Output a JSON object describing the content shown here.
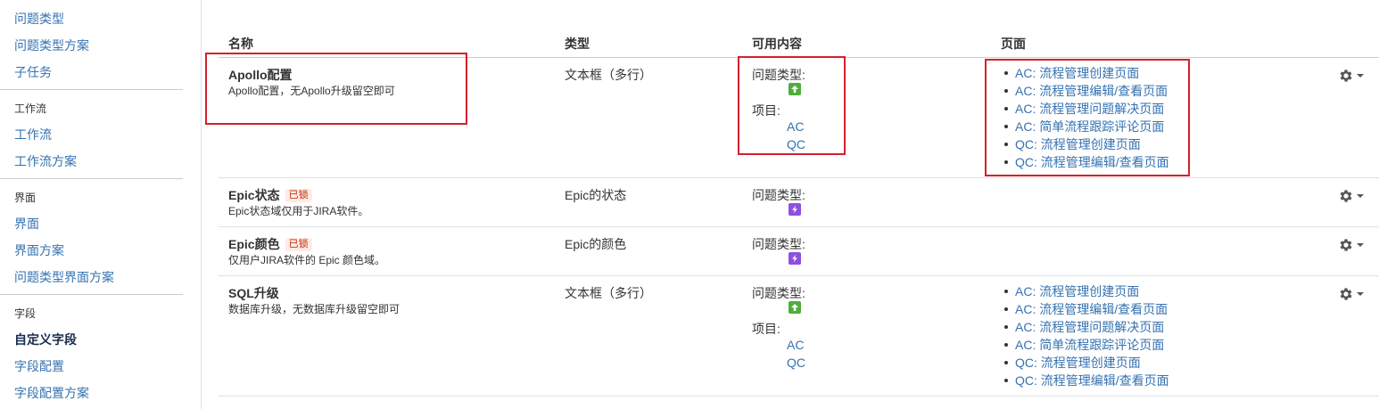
{
  "sidebar": {
    "links_top": [
      "问题类型",
      "问题类型方案",
      "子任务"
    ],
    "sections": [
      {
        "heading": "工作流",
        "items": [
          "工作流",
          "工作流方案"
        ]
      },
      {
        "heading": "界面",
        "items": [
          "界面",
          "界面方案",
          "问题类型界面方案"
        ]
      },
      {
        "heading": "字段",
        "items": [
          "自定义字段",
          "字段配置",
          "字段配置方案"
        ]
      }
    ],
    "current_item": "自定义字段"
  },
  "table": {
    "headers": {
      "name": "名称",
      "type": "类型",
      "context": "可用内容",
      "screens": "页面"
    },
    "issue_type_label": "问题类型:",
    "project_label": "项目:",
    "rows": [
      {
        "name": "Apollo配置",
        "locked": "",
        "description": "Apollo配置，无Apollo升级留空即可",
        "type": "文本框（多行）",
        "issue_type_icon": "story-arrow-up-icon",
        "projects": [
          "AC",
          "QC"
        ],
        "screens": [
          "AC: 流程管理创建页面",
          "AC: 流程管理编辑/查看页面",
          "AC: 流程管理问题解决页面",
          "AC: 简单流程跟踪评论页面",
          "QC: 流程管理创建页面",
          "QC: 流程管理编辑/查看页面"
        ]
      },
      {
        "name": "Epic状态",
        "locked": "已锁",
        "description": "Epic状态域仅用于JIRA软件。",
        "type": "Epic的状态",
        "issue_type_icon": "epic-lightning-icon",
        "projects": [],
        "screens": []
      },
      {
        "name": "Epic颜色",
        "locked": "已锁",
        "description": "仅用户JIRA软件的 Epic 颜色域。",
        "type": "Epic的颜色",
        "issue_type_icon": "epic-lightning-icon",
        "projects": [],
        "screens": []
      },
      {
        "name": "SQL升级",
        "locked": "",
        "description": "数据库升级，无数据库升级留空即可",
        "type": "文本框（多行）",
        "issue_type_icon": "story-arrow-up-icon",
        "projects": [
          "AC",
          "QC"
        ],
        "screens": [
          "AC: 流程管理创建页面",
          "AC: 流程管理编辑/查看页面",
          "AC: 流程管理问题解决页面",
          "AC: 简单流程跟踪评论页面",
          "QC: 流程管理创建页面",
          "QC: 流程管理编辑/查看页面"
        ]
      }
    ]
  },
  "colors": {
    "link": "#3572b0",
    "highlight_box": "#d4202c",
    "story_icon": "#4fad3a",
    "epic_icon": "#8e4fe0",
    "locked_lozenge_bg": "#ffebe6"
  }
}
